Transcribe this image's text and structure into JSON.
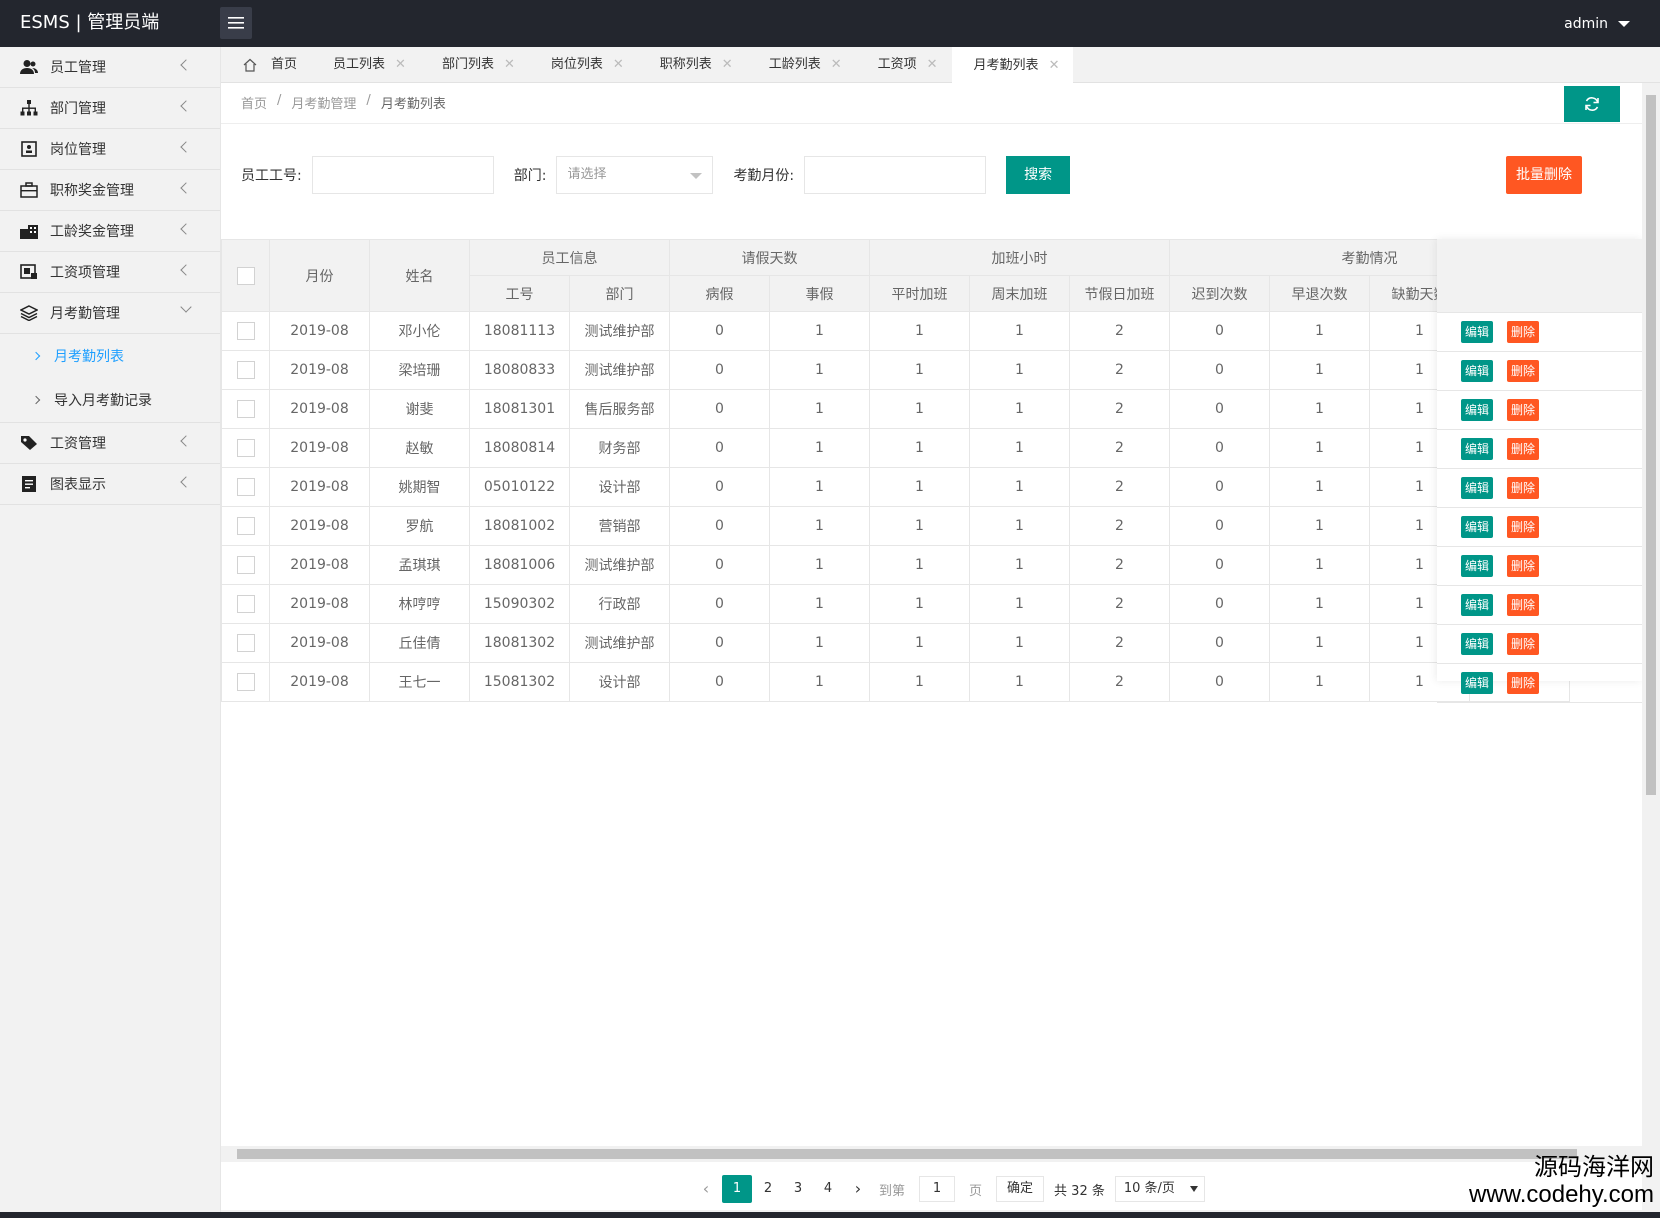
{
  "app": {
    "title": "ESMS | 管理员端",
    "user": "admin"
  },
  "sidebar": {
    "items": [
      {
        "label": "员工管理",
        "icon": "users-icon"
      },
      {
        "label": "部门管理",
        "icon": "sitemap-icon"
      },
      {
        "label": "岗位管理",
        "icon": "badge-icon"
      },
      {
        "label": "职称奖金管理",
        "icon": "briefcase-icon"
      },
      {
        "label": "工龄奖金管理",
        "icon": "building-icon"
      },
      {
        "label": "工资项管理",
        "icon": "list-icon"
      },
      {
        "label": "月考勤管理",
        "icon": "layers-icon"
      },
      {
        "label": "工资管理",
        "icon": "tag-icon"
      },
      {
        "label": "图表显示",
        "icon": "document-icon"
      }
    ],
    "sub_items": [
      {
        "label": "月考勤列表",
        "active": true
      },
      {
        "label": "导入月考勤记录",
        "active": false
      }
    ]
  },
  "tabs": [
    {
      "label": "首页",
      "closable": false
    },
    {
      "label": "员工列表",
      "closable": true
    },
    {
      "label": "部门列表",
      "closable": true
    },
    {
      "label": "岗位列表",
      "closable": true
    },
    {
      "label": "职称列表",
      "closable": true
    },
    {
      "label": "工龄列表",
      "closable": true
    },
    {
      "label": "工资项",
      "closable": true
    },
    {
      "label": "月考勤列表",
      "closable": true,
      "active": true
    }
  ],
  "breadcrumb": [
    "首页",
    "月考勤管理",
    "月考勤列表"
  ],
  "search": {
    "emp_no_label": "员工工号:",
    "dept_label": "部门:",
    "dept_placeholder": "请选择",
    "month_label": "考勤月份:",
    "search_button": "搜索",
    "batch_delete_button": "批量删除"
  },
  "table": {
    "group_headers": {
      "emp_info": "员工信息",
      "leave": "请假天数",
      "overtime": "加班小时",
      "attendance": "考勤情况"
    },
    "headers": {
      "month": "月份",
      "name": "姓名",
      "emp_no": "工号",
      "dept": "部门",
      "sick": "病假",
      "personal": "事假",
      "weekday_ot": "平时加班",
      "weekend_ot": "周末加班",
      "holiday_ot": "节假日加班",
      "late": "迟到次数",
      "early": "早退次数",
      "absent": "缺勤天数"
    },
    "edit_label": "编辑",
    "delete_label": "删除",
    "rows": [
      {
        "month": "2019-08",
        "name": "邓小伦",
        "emp_no": "18081113",
        "dept": "测试维护部",
        "sick": "0",
        "personal": "1",
        "weekday_ot": "1",
        "weekend_ot": "1",
        "holiday_ot": "2",
        "late": "0",
        "early": "1",
        "absent": "1"
      },
      {
        "month": "2019-08",
        "name": "梁培珊",
        "emp_no": "18080833",
        "dept": "测试维护部",
        "sick": "0",
        "personal": "1",
        "weekday_ot": "1",
        "weekend_ot": "1",
        "holiday_ot": "2",
        "late": "0",
        "early": "1",
        "absent": "1"
      },
      {
        "month": "2019-08",
        "name": "谢斐",
        "emp_no": "18081301",
        "dept": "售后服务部",
        "sick": "0",
        "personal": "1",
        "weekday_ot": "1",
        "weekend_ot": "1",
        "holiday_ot": "2",
        "late": "0",
        "early": "1",
        "absent": "1"
      },
      {
        "month": "2019-08",
        "name": "赵敏",
        "emp_no": "18080814",
        "dept": "财务部",
        "sick": "0",
        "personal": "1",
        "weekday_ot": "1",
        "weekend_ot": "1",
        "holiday_ot": "2",
        "late": "0",
        "early": "1",
        "absent": "1"
      },
      {
        "month": "2019-08",
        "name": "姚期智",
        "emp_no": "05010122",
        "dept": "设计部",
        "sick": "0",
        "personal": "1",
        "weekday_ot": "1",
        "weekend_ot": "1",
        "holiday_ot": "2",
        "late": "0",
        "early": "1",
        "absent": "1"
      },
      {
        "month": "2019-08",
        "name": "罗航",
        "emp_no": "18081002",
        "dept": "营销部",
        "sick": "0",
        "personal": "1",
        "weekday_ot": "1",
        "weekend_ot": "1",
        "holiday_ot": "2",
        "late": "0",
        "early": "1",
        "absent": "1"
      },
      {
        "month": "2019-08",
        "name": "孟琪琪",
        "emp_no": "18081006",
        "dept": "测试维护部",
        "sick": "0",
        "personal": "1",
        "weekday_ot": "1",
        "weekend_ot": "1",
        "holiday_ot": "2",
        "late": "0",
        "early": "1",
        "absent": "1"
      },
      {
        "month": "2019-08",
        "name": "林哼哼",
        "emp_no": "15090302",
        "dept": "行政部",
        "sick": "0",
        "personal": "1",
        "weekday_ot": "1",
        "weekend_ot": "1",
        "holiday_ot": "2",
        "late": "0",
        "early": "1",
        "absent": "1"
      },
      {
        "month": "2019-08",
        "name": "丘佳倩",
        "emp_no": "18081302",
        "dept": "测试维护部",
        "sick": "0",
        "personal": "1",
        "weekday_ot": "1",
        "weekend_ot": "1",
        "holiday_ot": "2",
        "late": "0",
        "early": "1",
        "absent": "1"
      },
      {
        "month": "2019-08",
        "name": "王七一",
        "emp_no": "15081302",
        "dept": "设计部",
        "sick": "0",
        "personal": "1",
        "weekday_ot": "1",
        "weekend_ot": "1",
        "holiday_ot": "2",
        "late": "0",
        "early": "1",
        "absent": "1"
      }
    ]
  },
  "pagination": {
    "pages": [
      "1",
      "2",
      "3",
      "4"
    ],
    "current": "1",
    "goto_label": "到第",
    "goto_value": "1",
    "page_suffix": "页",
    "confirm": "确定",
    "total": "共 32 条",
    "page_size": "10 条/页"
  },
  "watermark": {
    "line1": "源码海洋网",
    "line2": "www.codehy.com"
  },
  "colors": {
    "header": "#23262e",
    "primary": "#009688",
    "danger": "#ff5722",
    "active_link": "#1e9fff"
  }
}
